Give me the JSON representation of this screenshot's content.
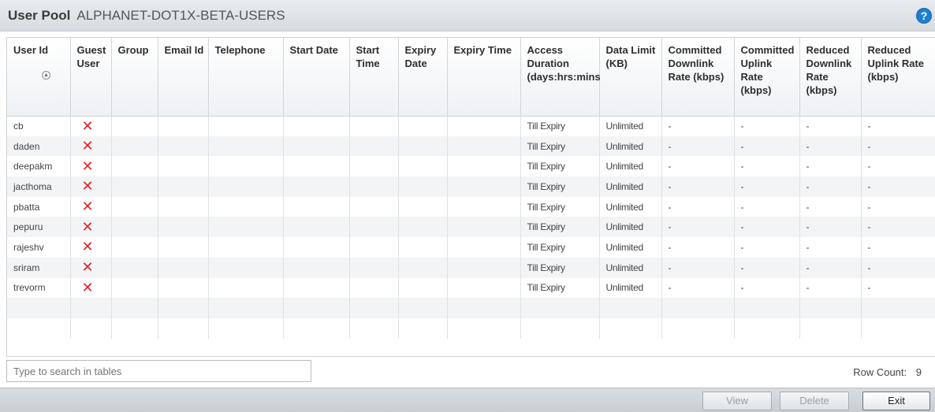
{
  "header": {
    "title": "User Pool",
    "pool_name": "ALPHANET-DOT1X-BETA-USERS",
    "help_icon": "?"
  },
  "columns": [
    "User Id",
    "Guest User",
    "Group",
    "Email Id",
    "Telephone",
    "Start Date",
    "Start Time",
    "Expiry Date",
    "Expiry Time",
    "Access Duration (days:hrs:mins:secs)",
    "Data Limit (KB)",
    "Committed Downlink Rate (kbps)",
    "Committed Uplink Rate (kbps)",
    "Reduced Downlink Rate (kbps)",
    "Reduced Uplink Rate (kbps)"
  ],
  "rows": [
    {
      "user_id": "cb",
      "guest_user": "✕",
      "group": "",
      "email": "",
      "telephone": "",
      "start_date": "",
      "start_time": "",
      "expiry_date": "",
      "expiry_time": "",
      "access_duration": "Till Expiry",
      "data_limit": "Unlimited",
      "committed_down": "-",
      "committed_up": "-",
      "reduced_down": "-",
      "reduced_up": "-"
    },
    {
      "user_id": "daden",
      "guest_user": "✕",
      "group": "",
      "email": "",
      "telephone": "",
      "start_date": "",
      "start_time": "",
      "expiry_date": "",
      "expiry_time": "",
      "access_duration": "Till Expiry",
      "data_limit": "Unlimited",
      "committed_down": "-",
      "committed_up": "-",
      "reduced_down": "-",
      "reduced_up": "-"
    },
    {
      "user_id": "deepakm",
      "guest_user": "✕",
      "group": "",
      "email": "",
      "telephone": "",
      "start_date": "",
      "start_time": "",
      "expiry_date": "",
      "expiry_time": "",
      "access_duration": "Till Expiry",
      "data_limit": "Unlimited",
      "committed_down": "-",
      "committed_up": "-",
      "reduced_down": "-",
      "reduced_up": "-"
    },
    {
      "user_id": "jacthoma",
      "guest_user": "✕",
      "group": "",
      "email": "",
      "telephone": "",
      "start_date": "",
      "start_time": "",
      "expiry_date": "",
      "expiry_time": "",
      "access_duration": "Till Expiry",
      "data_limit": "Unlimited",
      "committed_down": "-",
      "committed_up": "-",
      "reduced_down": "-",
      "reduced_up": "-"
    },
    {
      "user_id": "pbatta",
      "guest_user": "✕",
      "group": "",
      "email": "",
      "telephone": "",
      "start_date": "",
      "start_time": "",
      "expiry_date": "",
      "expiry_time": "",
      "access_duration": "Till Expiry",
      "data_limit": "Unlimited",
      "committed_down": "-",
      "committed_up": "-",
      "reduced_down": "-",
      "reduced_up": "-"
    },
    {
      "user_id": "pepuru",
      "guest_user": "✕",
      "group": "",
      "email": "",
      "telephone": "",
      "start_date": "",
      "start_time": "",
      "expiry_date": "",
      "expiry_time": "",
      "access_duration": "Till Expiry",
      "data_limit": "Unlimited",
      "committed_down": "-",
      "committed_up": "-",
      "reduced_down": "-",
      "reduced_up": "-"
    },
    {
      "user_id": "rajeshv",
      "guest_user": "✕",
      "group": "",
      "email": "",
      "telephone": "",
      "start_date": "",
      "start_time": "",
      "expiry_date": "",
      "expiry_time": "",
      "access_duration": "Till Expiry",
      "data_limit": "Unlimited",
      "committed_down": "-",
      "committed_up": "-",
      "reduced_down": "-",
      "reduced_up": "-"
    },
    {
      "user_id": "sriram",
      "guest_user": "✕",
      "group": "",
      "email": "",
      "telephone": "",
      "start_date": "",
      "start_time": "",
      "expiry_date": "",
      "expiry_time": "",
      "access_duration": "Till Expiry",
      "data_limit": "Unlimited",
      "committed_down": "-",
      "committed_up": "-",
      "reduced_down": "-",
      "reduced_up": "-"
    },
    {
      "user_id": "trevorm",
      "guest_user": "✕",
      "group": "",
      "email": "",
      "telephone": "",
      "start_date": "",
      "start_time": "",
      "expiry_date": "",
      "expiry_time": "",
      "access_duration": "Till Expiry",
      "data_limit": "Unlimited",
      "committed_down": "-",
      "committed_up": "-",
      "reduced_down": "-",
      "reduced_up": "-"
    }
  ],
  "search": {
    "placeholder": "Type to search in tables"
  },
  "row_count": {
    "label": "Row Count:",
    "value": "9"
  },
  "buttons": {
    "view": "View",
    "delete": "Delete",
    "exit": "Exit"
  },
  "icons": {
    "help": "help-icon",
    "sort": "sort-ascending-icon",
    "guest_no": "x-mark-icon"
  },
  "colors": {
    "accent": "#1e7fd0",
    "x_mark": "#e0242b"
  }
}
